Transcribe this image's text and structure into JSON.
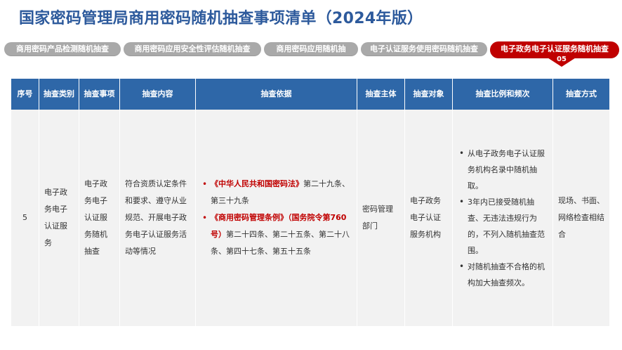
{
  "title": "国家密码管理局商用密码随机抽查事项清单（2024年版）",
  "tabs": [
    {
      "label": "商用密码产品检测随机抽查",
      "active": false
    },
    {
      "label": "商用密码应用安全性评估随机抽查",
      "active": false
    },
    {
      "label": "商用密码应用随机抽",
      "active": false
    },
    {
      "label": "电子认证服务使用密码随机抽查",
      "active": false
    },
    {
      "label": "电子政务电子认证服务随机抽查",
      "active": true,
      "number": "05"
    }
  ],
  "table": {
    "headers": [
      {
        "key": "no",
        "label": "序号"
      },
      {
        "key": "category",
        "label": "抽查类别"
      },
      {
        "key": "item",
        "label": "抽查事项"
      },
      {
        "key": "content",
        "label": "抽查内容"
      },
      {
        "key": "basis",
        "label": "抽查依据"
      },
      {
        "key": "subject",
        "label": "抽查主体"
      },
      {
        "key": "target",
        "label": "抽查对象"
      },
      {
        "key": "ratio",
        "label": "抽查比例和频次"
      },
      {
        "key": "method",
        "label": "抽查方式"
      }
    ],
    "row": {
      "no": "5",
      "category": "电子政务电子认证服务",
      "item": "电子政务电子认证服务随机抽查",
      "content": "符合资质认定条件和要求、遵守从业规范、开展电子政务电子认证服务活动等情况",
      "basis": [
        {
          "law": "《中华人民共和国密码法》",
          "articles": "第二十九条、第三十九条"
        },
        {
          "law": "《商用密码管理条例》（国务院令第760号）",
          "articles": "第二十四条、第二十五条、第二十八条、第四十七条、第五十五条"
        }
      ],
      "subject": "密码管理部门",
      "target": "电子政务电子认证服务机构",
      "ratio": [
        "从电子政务电子认证服务机构名录中随机抽取。",
        "3年内已接受随机抽查、无违法违规行为的，不列入随机抽查范围。",
        "对随机抽查不合格的机构加大抽查频次。"
      ],
      "method": "现场、书面、网络检查相结合"
    }
  },
  "colors": {
    "title": "#2d5a9c",
    "header_bg": "#2e67a8",
    "active_tab": "#c00000",
    "inactive_tab": "#a9a9a9",
    "cell_bg": "#f2f2f2",
    "law_text": "#c00000"
  }
}
